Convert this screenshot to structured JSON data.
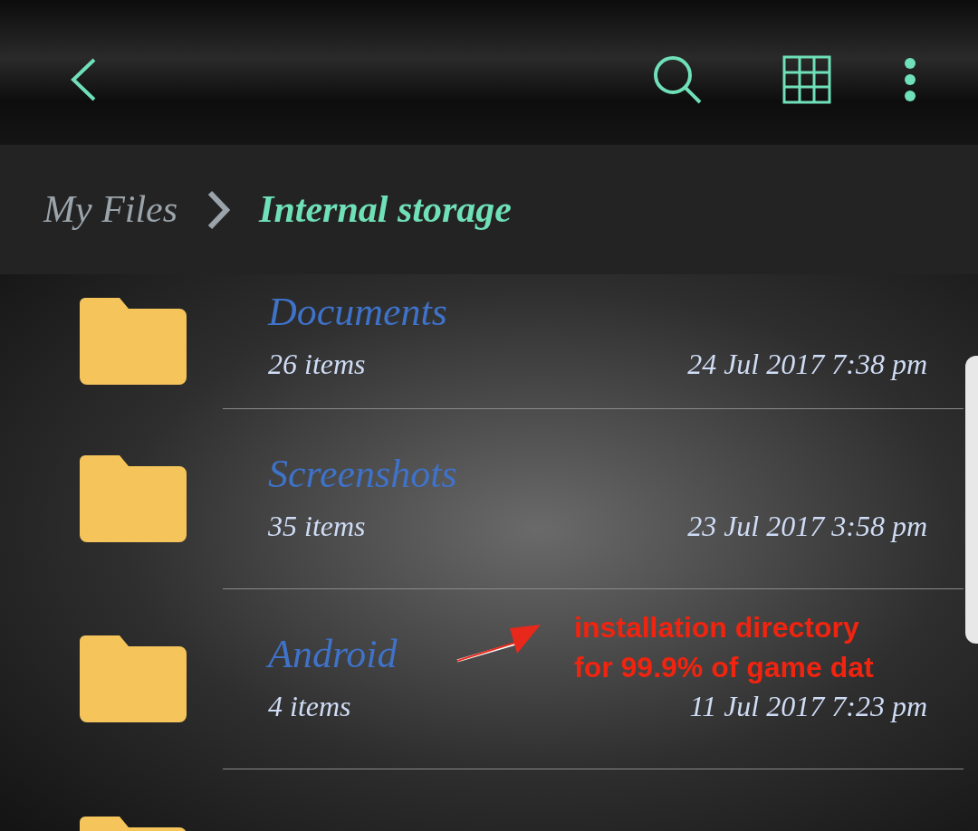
{
  "breadcrumb": [
    {
      "label": "My Files",
      "selected": false
    },
    {
      "label": "Internal storage",
      "selected": true
    }
  ],
  "folders": [
    {
      "name": "Documents",
      "count": "26 items",
      "date": "24 Jul 2017 7:38 pm"
    },
    {
      "name": "Screenshots",
      "count": "35 items",
      "date": "23 Jul 2017 3:58 pm"
    },
    {
      "name": "Android",
      "count": "4 items",
      "date": "11 Jul 2017 7:23 pm"
    }
  ],
  "annotation": {
    "lines": [
      "installation directory",
      "for 99.9% of game dat"
    ]
  }
}
